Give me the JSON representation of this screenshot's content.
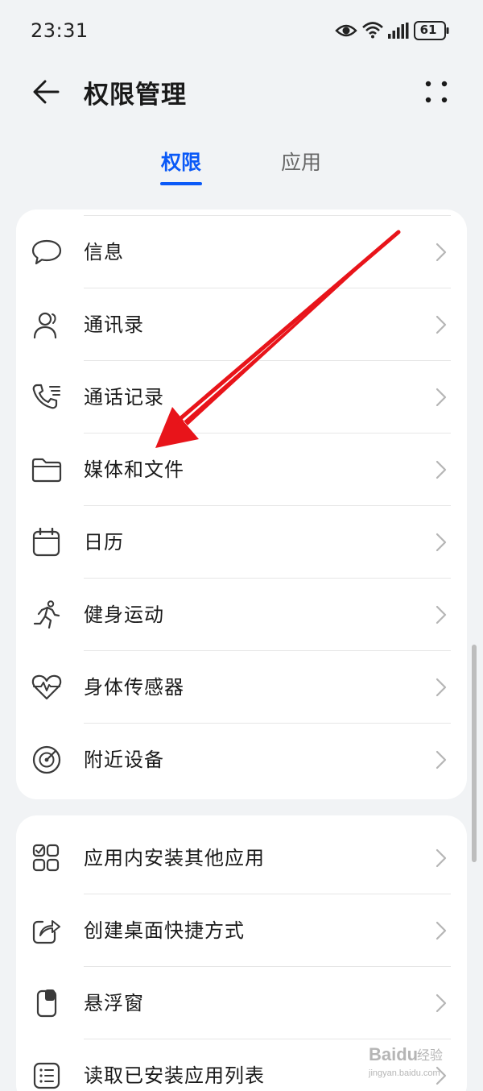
{
  "status_bar": {
    "time": "23:31",
    "battery": "61",
    "icons": [
      "eye-icon",
      "wifi-icon",
      "signal-icon",
      "battery-icon"
    ]
  },
  "header": {
    "title": "权限管理",
    "back_icon": "arrow-left-icon",
    "more_icon": "more-dots-icon"
  },
  "tabs": [
    {
      "label": "权限",
      "active": true
    },
    {
      "label": "应用",
      "active": false
    }
  ],
  "colors": {
    "accent": "#0a59f7",
    "background": "#f1f3f5",
    "card": "#ffffff",
    "annotation_arrow": "#e8141a"
  },
  "permission_group": [
    {
      "label": "信息",
      "icon": "message-bubble-icon"
    },
    {
      "label": "通讯录",
      "icon": "contacts-icon"
    },
    {
      "label": "通话记录",
      "icon": "call-log-icon"
    },
    {
      "label": "媒体和文件",
      "icon": "folder-icon"
    },
    {
      "label": "日历",
      "icon": "calendar-icon"
    },
    {
      "label": "健身运动",
      "icon": "running-icon"
    },
    {
      "label": "身体传感器",
      "icon": "heart-rate-icon"
    },
    {
      "label": "附近设备",
      "icon": "nearby-radar-icon"
    }
  ],
  "special_group": [
    {
      "label": "应用内安装其他应用",
      "icon": "app-grid-icon"
    },
    {
      "label": "创建桌面快捷方式",
      "icon": "shortcut-share-icon"
    },
    {
      "label": "悬浮窗",
      "icon": "floating-window-icon"
    },
    {
      "label": "读取已安装应用列表",
      "icon": "list-icon"
    }
  ],
  "watermark": {
    "brand": "Baidu",
    "suffix": "经验",
    "url": "jingyan.baidu.com"
  }
}
